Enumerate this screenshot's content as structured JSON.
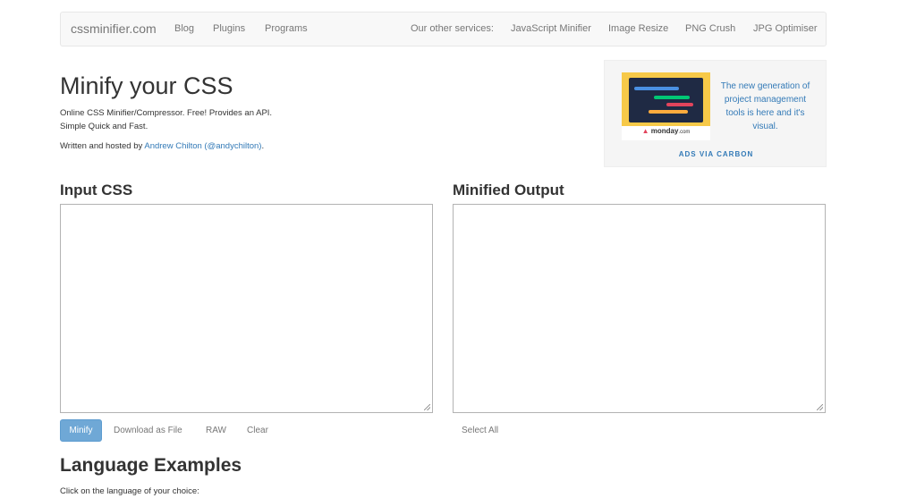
{
  "nav": {
    "brand": "cssminifier.com",
    "links": [
      "Blog",
      "Plugins",
      "Programs"
    ],
    "services_label": "Our other services:",
    "services": [
      "JavaScript Minifier",
      "Image Resize",
      "PNG Crush",
      "JPG Optimiser"
    ]
  },
  "hero": {
    "title": "Minify your CSS",
    "line1": "Online CSS Minifier/Compressor. Free! Provides an API.",
    "line2": "Simple Quick and Fast.",
    "credit_prefix": "Written and hosted by ",
    "author": "Andrew Chilton",
    "handle": "(@andychilton)",
    "credit_suffix": "."
  },
  "ad": {
    "logo": "monday",
    "logo_suffix": ".com",
    "text": "The new generation of project management tools is here and it's visual.",
    "via": "ADS VIA CARBON"
  },
  "input": {
    "heading": "Input CSS",
    "value": "",
    "buttons": {
      "minify": "Minify",
      "download": "Download as File",
      "raw": "RAW",
      "clear": "Clear"
    }
  },
  "output": {
    "heading": "Minified Output",
    "value": "",
    "select_all": "Select All"
  },
  "examples": {
    "heading": "Language Examples",
    "subtitle": "Click on the language of your choice:"
  },
  "colors": {
    "link": "#337ab7",
    "primary_button": "#6fa8d6",
    "navbar_bg": "#f8f8f8"
  }
}
